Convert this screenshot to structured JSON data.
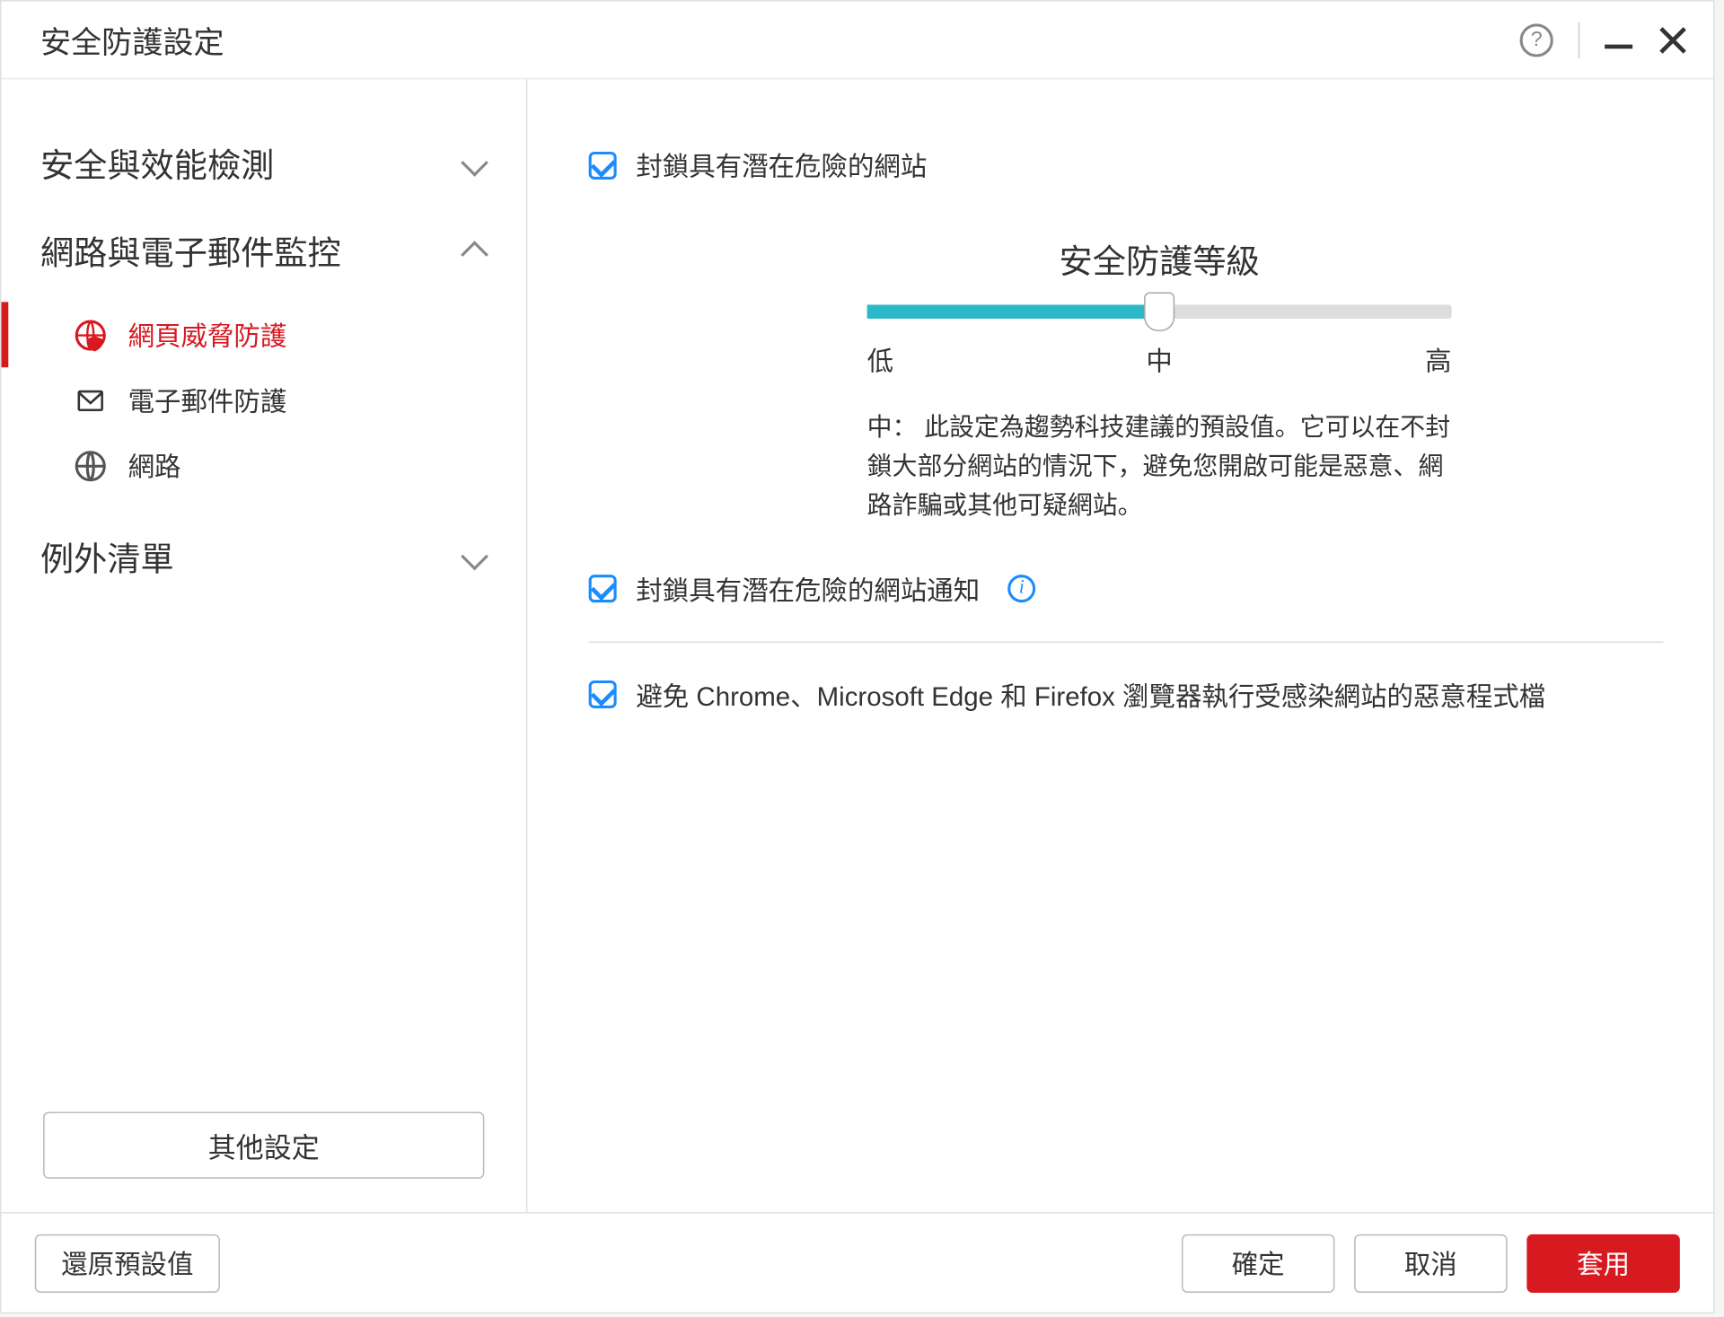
{
  "titlebar": {
    "title": "安全防護設定"
  },
  "sidebar": {
    "sections": [
      {
        "label": "安全與效能檢測",
        "expanded": false
      },
      {
        "label": "網路與電子郵件監控",
        "expanded": true
      },
      {
        "label": "例外清單",
        "expanded": false
      }
    ],
    "sub_items": [
      {
        "label": "網頁威脅防護",
        "icon": "globe-shield-icon",
        "active": true
      },
      {
        "label": "電子郵件防護",
        "icon": "mail-icon",
        "active": false
      },
      {
        "label": "網路",
        "icon": "globe-net-icon",
        "active": false
      }
    ],
    "other_settings": "其他設定"
  },
  "content": {
    "check1": "封鎖具有潛在危險的網站",
    "slider": {
      "title": "安全防護等級",
      "low": "低",
      "mid": "中",
      "high": "高",
      "value_percent": 50,
      "desc": "中： 此設定為趨勢科技建議的預設值。它可以在不封鎖大部分網站的情況下，避免您開啟可能是惡意、網路詐騙或其他可疑網站。"
    },
    "check2": "封鎖具有潛在危險的網站通知",
    "check3": "避免 Chrome、Microsoft Edge 和 Firefox 瀏覽器執行受感染網站的惡意程式檔"
  },
  "footer": {
    "restore": "還原預設值",
    "ok": "確定",
    "cancel": "取消",
    "apply": "套用"
  }
}
